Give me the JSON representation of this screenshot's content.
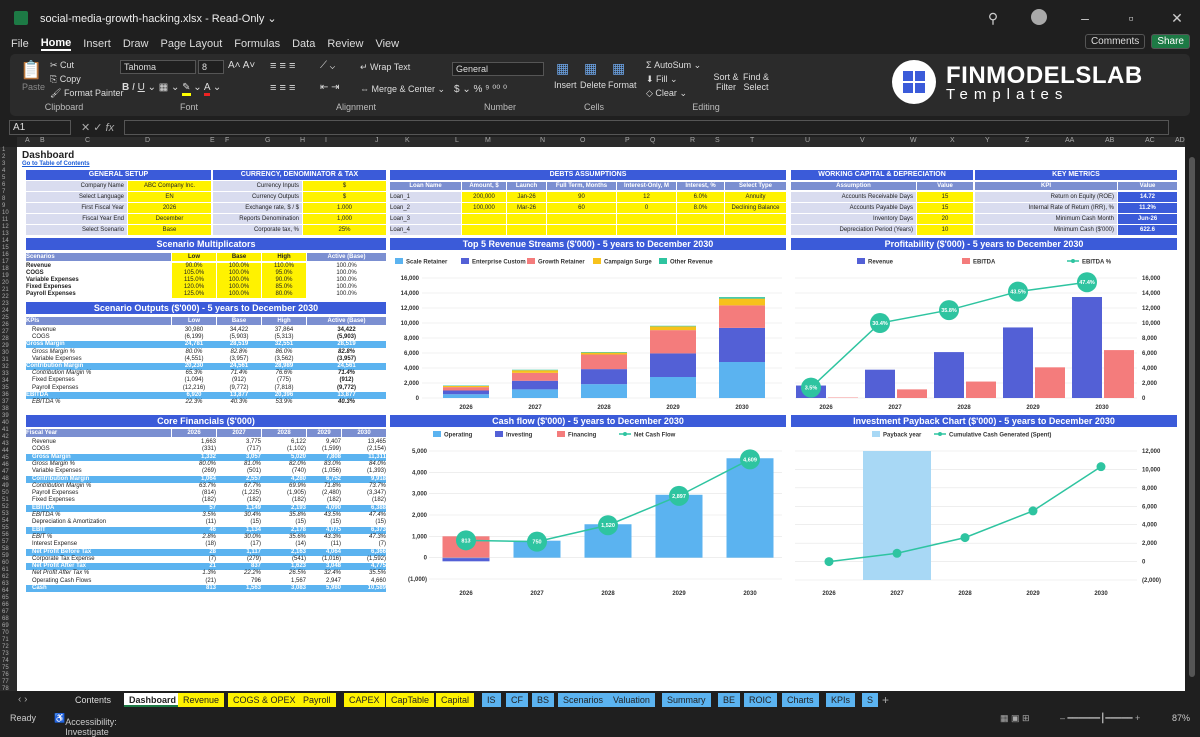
{
  "window": {
    "filename": "social-media-growth-hacking.xlsx",
    "mode": "Read-Only"
  },
  "menu": [
    "File",
    "Home",
    "Insert",
    "Draw",
    "Page Layout",
    "Formulas",
    "Data",
    "Review",
    "View"
  ],
  "menu_buttons": {
    "comments": "Comments",
    "share": "Share"
  },
  "ribbon": {
    "clipboard": {
      "paste": "Paste",
      "cut": "Cut",
      "copy": "Copy",
      "format_painter": "Format Painter",
      "label": "Clipboard"
    },
    "font": {
      "name": "Tahoma",
      "size": "8",
      "label": "Font"
    },
    "alignment": {
      "wrap": "Wrap Text",
      "merge": "Merge & Center",
      "label": "Alignment"
    },
    "number": {
      "format": "General",
      "label": "Number"
    },
    "cells": {
      "insert": "Insert",
      "delete": "Delete",
      "format": "Format",
      "label": "Cells"
    },
    "editing": {
      "autosum": "AutoSum",
      "fill": "Fill",
      "clear": "Clear",
      "sort": "Sort & Filter",
      "find": "Find & Select",
      "label": "Editing"
    }
  },
  "brand": {
    "line1": "FINMODELSLAB",
    "line2": "Templates"
  },
  "formula_bar": {
    "cell": "A1",
    "fx": "fx"
  },
  "columns": [
    "A",
    "B",
    "C",
    "D",
    "E",
    "F",
    "G",
    "H",
    "I",
    "J",
    "K",
    "L",
    "M",
    "N",
    "O",
    "P",
    "Q",
    "R",
    "S",
    "T",
    "U",
    "V",
    "W",
    "X",
    "Y",
    "Z",
    "AA",
    "AB",
    "AC",
    "AD"
  ],
  "dashboard": {
    "title": "Dashboard",
    "toc": "Go to Table of Contents",
    "general_setup": {
      "header": "GENERAL SETUP",
      "rows": [
        [
          "Company Name",
          "ABC Company Inc."
        ],
        [
          "Select Language",
          "EN"
        ],
        [
          "First Fiscal Year",
          "2026"
        ],
        [
          "Fiscal Year End",
          "December"
        ],
        [
          "Select Scenario",
          "Base"
        ]
      ]
    },
    "currency": {
      "header": "CURRENCY, DENOMINATOR & TAX",
      "rows": [
        [
          "Currency Inputs",
          "$"
        ],
        [
          "Currency Outputs",
          "$"
        ],
        [
          "Exchange rate, $ / $",
          "1.000"
        ],
        [
          "Reports Denomination",
          "1,000"
        ],
        [
          "Corporate tax, %",
          "25%"
        ]
      ]
    },
    "debts": {
      "header": "DEBTS ASSUMPTIONS",
      "cols": [
        "Loan Name",
        "Amount, $",
        "Launch",
        "Full Term, Months",
        "Interest-Only, M",
        "Interest, %",
        "Select Type"
      ],
      "rows": [
        [
          "Loan_1",
          "200,000",
          "Jan-26",
          "90",
          "12",
          "6.0%",
          "Annuity"
        ],
        [
          "Loan_2",
          "100,000",
          "Mar-26",
          "60",
          "0",
          "8.0%",
          "Declining Balance"
        ],
        [
          "Loan_3",
          "",
          "",
          "",
          "",
          "",
          ""
        ],
        [
          "Loan_4",
          "",
          "",
          "",
          "",
          "",
          ""
        ]
      ]
    },
    "working_capital": {
      "header": "WORKING CAPITAL & DEPRECIATION",
      "cols": [
        "Assumption",
        "Value"
      ],
      "rows": [
        [
          "Accounts Receivable Days",
          "15"
        ],
        [
          "Accounts Payable Days",
          "15"
        ],
        [
          "Inventory Days",
          "20"
        ],
        [
          "Depreciation Period (Years)",
          "10"
        ]
      ]
    },
    "key_metrics": {
      "header": "KEY METRICS",
      "cols": [
        "KPI",
        "Value"
      ],
      "rows": [
        [
          "Return on Equity (ROE)",
          "14.72"
        ],
        [
          "Internal Rate of Return (IRR), %",
          "11.2%"
        ],
        [
          "Minimum Cash Month",
          "Jun-26"
        ],
        [
          "Minimum Cash ($'000)",
          "622.6"
        ]
      ]
    },
    "scenario_mult": {
      "header": "Scenario Multiplicators",
      "cols": [
        "Scenarios",
        "Low",
        "Base",
        "High",
        "Active (Base)"
      ],
      "rows": [
        [
          "Revenue",
          "90.0%",
          "100.0%",
          "110.0%",
          "100.0%"
        ],
        [
          "COGS",
          "105.0%",
          "100.0%",
          "95.0%",
          "100.0%"
        ],
        [
          "Variable Expenses",
          "115.0%",
          "100.0%",
          "90.0%",
          "100.0%"
        ],
        [
          "Fixed Expenses",
          "120.0%",
          "100.0%",
          "85.0%",
          "100.0%"
        ],
        [
          "Payroll Expenses",
          "125.0%",
          "100.0%",
          "80.0%",
          "100.0%"
        ]
      ]
    },
    "scenario_out": {
      "header": "Scenario Outputs ($'000) - 5 years to December 2030",
      "cols": [
        "KPIs",
        "Low",
        "Base",
        "High",
        "Active (Base)"
      ],
      "rows": [
        [
          "Revenue",
          "30,980",
          "34,422",
          "37,864",
          "34,422",
          "n"
        ],
        [
          "COGS",
          "(6,199)",
          "(5,903)",
          "(5,313)",
          "(5,903)",
          "n"
        ],
        [
          "Gross Margin",
          "24,781",
          "28,519",
          "32,551",
          "28,519",
          "b"
        ],
        [
          "Gross Margin %",
          "80.0%",
          "82.8%",
          "86.0%",
          "82.8%",
          "i"
        ],
        [
          "Variable Expenses",
          "(4,551)",
          "(3,957)",
          "(3,562)",
          "(3,957)",
          "n"
        ],
        [
          "Contribution Margin",
          "20,230",
          "24,561",
          "28,989",
          "24,561",
          "b"
        ],
        [
          "Contribution Margin %",
          "65.3%",
          "71.4%",
          "76.6%",
          "71.4%",
          "i"
        ],
        [
          "Fixed Expenses",
          "(1,094)",
          "(912)",
          "(775)",
          "(912)",
          "n"
        ],
        [
          "Payroll Expenses",
          "(12,216)",
          "(9,772)",
          "(7,818)",
          "(9,772)",
          "n"
        ],
        [
          "EBITDA",
          "6,920",
          "13,877",
          "20,396",
          "13,877",
          "b"
        ],
        [
          "EBITDA %",
          "22.3%",
          "40.3%",
          "53.9%",
          "40.3%",
          "i"
        ]
      ]
    },
    "core": {
      "header": "Core Financials ($'000)",
      "cols": [
        "Fiscal Year",
        "2026",
        "2027",
        "2028",
        "2029",
        "2030"
      ],
      "rows": [
        [
          "Revenue",
          "1,663",
          "3,775",
          "6,122",
          "9,407",
          "13,465",
          "n"
        ],
        [
          "COGS",
          "(331)",
          "(717)",
          "(1,102)",
          "(1,599)",
          "(2,154)",
          "n"
        ],
        [
          "Gross Margin",
          "1,332",
          "3,057",
          "5,020",
          "7,808",
          "11,311",
          "b"
        ],
        [
          "Gross Margin %",
          "80.0%",
          "81.0%",
          "82.0%",
          "83.0%",
          "84.0%",
          "i"
        ],
        [
          "Variable Expenses",
          "(269)",
          "(501)",
          "(740)",
          "(1,056)",
          "(1,393)",
          "n"
        ],
        [
          "Contribution Margin",
          "1,064",
          "2,557",
          "4,280",
          "6,752",
          "9,918",
          "b"
        ],
        [
          "Contribution Margin %",
          "63.7%",
          "67.7%",
          "69.9%",
          "71.8%",
          "73.7%",
          "i"
        ],
        [
          "Payroll Expenses",
          "(814)",
          "(1,225)",
          "(1,905)",
          "(2,480)",
          "(3,347)",
          "n"
        ],
        [
          "Fixed Expenses",
          "(182)",
          "(182)",
          "(182)",
          "(182)",
          "(182)",
          "n"
        ],
        [
          "EBITDA",
          "57",
          "1,149",
          "2,193",
          "4,090",
          "6,388",
          "b"
        ],
        [
          "EBITDA %",
          "3.5%",
          "30.4%",
          "35.8%",
          "43.5%",
          "47.4%",
          "i"
        ],
        [
          "Depreciation & Amortization",
          "(11)",
          "(15)",
          "(15)",
          "(15)",
          "(15)",
          "n"
        ],
        [
          "EBIT",
          "46",
          "1,134",
          "2,178",
          "4,075",
          "6,373",
          "b"
        ],
        [
          "EBIT %",
          "2.8%",
          "30.0%",
          "35.6%",
          "43.3%",
          "47.3%",
          "i"
        ],
        [
          "Interest Expense",
          "(18)",
          "(17)",
          "(14)",
          "(11)",
          "(7)",
          "n"
        ],
        [
          "Net Profit Before Tax",
          "28",
          "1,117",
          "2,163",
          "4,064",
          "6,366",
          "b"
        ],
        [
          "Corporate Tax Expense",
          "(7)",
          "(279)",
          "(541)",
          "(1,016)",
          "(1,592)",
          "n"
        ],
        [
          "Net Profit After Tax",
          "21",
          "837",
          "1,623",
          "3,048",
          "4,775",
          "b"
        ],
        [
          "Net Profit After Tax %",
          "1.3%",
          "22.2%",
          "26.5%",
          "32.4%",
          "35.5%",
          "i"
        ],
        [
          "Operating Cash Flows",
          "(21)",
          "796",
          "1,567",
          "2,947",
          "4,660",
          "n"
        ],
        [
          "Cash",
          "813",
          "1,563",
          "3,083",
          "5,980",
          "10,589",
          "b"
        ]
      ]
    }
  },
  "chart_data": [
    {
      "type": "bar",
      "title": "Top 5 Revenue Streams ($'000) - 5 years to December 2030",
      "categories": [
        "2026",
        "2027",
        "2028",
        "2029",
        "2030"
      ],
      "series": [
        {
          "name": "Scale Retainer",
          "color": "#5bb3f0",
          "values": [
            500,
            1150,
            1850,
            2800,
            4800
          ]
        },
        {
          "name": "Enterprise Custom",
          "color": "#5360d6",
          "values": [
            500,
            1150,
            2000,
            3150,
            4550
          ]
        },
        {
          "name": "Growth Retainer",
          "color": "#f47c7c",
          "values": [
            450,
            1050,
            1950,
            3100,
            3000
          ]
        },
        {
          "name": "Campaign Surge",
          "color": "#f7c21c",
          "values": [
            150,
            350,
            250,
            500,
            900
          ]
        },
        {
          "name": "Other Revenue",
          "color": "#2ec4a0",
          "values": [
            60,
            70,
            80,
            80,
            200
          ]
        }
      ],
      "ylim": [
        0,
        16000
      ],
      "yticks": [
        "16,000",
        "14,000",
        "12,000",
        "10,000",
        "8,000",
        "6,000",
        "4,000",
        "2,000",
        "0"
      ]
    },
    {
      "type": "bar",
      "title": "Profitability ($'000) - 5 years to December 2030",
      "categories": [
        "2026",
        "2027",
        "2028",
        "2029",
        "2030"
      ],
      "series": [
        {
          "name": "Revenue",
          "color": "#5360d6",
          "values": [
            1663,
            3775,
            6122,
            9407,
            13465
          ]
        },
        {
          "name": "EBITDA",
          "color": "#f47c7c",
          "values": [
            57,
            1149,
            2193,
            4090,
            6388
          ]
        },
        {
          "name": "EBITDA %",
          "color": "#2ec4a0",
          "values": [
            3.5,
            30.4,
            35.8,
            43.5,
            47.4
          ],
          "labels": [
            "3.5%",
            "30.4%",
            "35.8%",
            "43.5%",
            "47.4%"
          ]
        }
      ],
      "ylim": [
        0,
        16000
      ],
      "yticks": [
        "16,000",
        "14,000",
        "12,000",
        "10,000",
        "8,000",
        "6,000",
        "4,000",
        "2,000",
        "0"
      ]
    },
    {
      "type": "bar",
      "title": "Cash flow ($'000) - 5 years to December 2030",
      "categories": [
        "2026",
        "2027",
        "2028",
        "2029",
        "2030"
      ],
      "series": [
        {
          "name": "Operating",
          "color": "#5bb3f0",
          "values": [
            -21,
            796,
            1567,
            2947,
            4660
          ]
        },
        {
          "name": "Investing",
          "color": "#5360d6",
          "values": [
            -150,
            0,
            0,
            0,
            0
          ]
        },
        {
          "name": "Financing",
          "color": "#f47c7c",
          "values": [
            1000,
            0,
            0,
            0,
            0
          ]
        },
        {
          "name": "Net Cash Flow",
          "color": "#2ec4a0",
          "values": [
            813,
            750,
            1520,
            2897,
            4609
          ],
          "labels": [
            "813",
            "750",
            "1,520",
            "2,897",
            "4,609"
          ]
        }
      ],
      "ylim": [
        -1000,
        5000
      ],
      "yticks": [
        "5,000",
        "4,000",
        "3,000",
        "2,000",
        "1,000",
        "0",
        "(1,000)"
      ]
    },
    {
      "type": "line",
      "title": "Investment Payback Chart ($'000) - 5 years to December 2030",
      "categories": [
        "2026",
        "2027",
        "2028",
        "2029",
        "2030"
      ],
      "series": [
        {
          "name": "Payback year",
          "color": "#a8d8f5",
          "values": [
            0,
            1,
            0,
            0,
            0
          ]
        },
        {
          "name": "Cumulative Cash Generated (Spent)",
          "color": "#2ec4a0",
          "values": [
            0,
            900,
            2600,
            5500,
            10300
          ]
        }
      ],
      "ylim": [
        -2000,
        12000
      ],
      "yticks": [
        "12,000",
        "10,000",
        "8,000",
        "6,000",
        "4,000",
        "2,000",
        "0",
        "(2,000)"
      ]
    }
  ],
  "tabs": [
    [
      "Contents",
      "#1f1f1f",
      "#ddd"
    ],
    [
      "Dashboard",
      "#fff",
      "#222"
    ],
    [
      "Revenue",
      "#fff200",
      "#222"
    ],
    [
      "COGS & OPEX",
      "#fff200",
      "#222"
    ],
    [
      "Payroll",
      "#fff200",
      "#222"
    ],
    [
      "CAPEX",
      "#fff200",
      "#222"
    ],
    [
      "CapTable",
      "#fff200",
      "#222"
    ],
    [
      "Capital",
      "#fff200",
      "#222"
    ],
    [
      "IS",
      "#5bb3f0",
      "#222"
    ],
    [
      "CF",
      "#5bb3f0",
      "#222"
    ],
    [
      "BS",
      "#5bb3f0",
      "#222"
    ],
    [
      "Scenarios",
      "#5bb3f0",
      "#222"
    ],
    [
      "Valuation",
      "#5bb3f0",
      "#222"
    ],
    [
      "Summary",
      "#5bb3f0",
      "#222"
    ],
    [
      "BE",
      "#5bb3f0",
      "#222"
    ],
    [
      "ROIC",
      "#5bb3f0",
      "#222"
    ],
    [
      "Charts",
      "#5bb3f0",
      "#222"
    ],
    [
      "KPIs",
      "#5bb3f0",
      "#222"
    ],
    [
      "S",
      "#5bb3f0",
      "#222"
    ]
  ],
  "status": {
    "ready": "Ready",
    "accessibility": "Accessibility: Investigate",
    "zoom": "87%"
  }
}
